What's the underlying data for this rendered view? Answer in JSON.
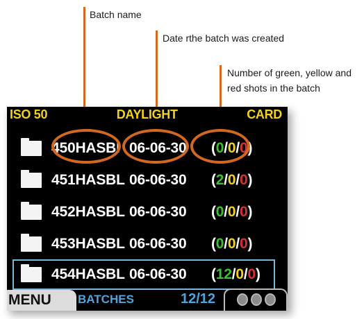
{
  "callouts": {
    "batch_name": "Batch name",
    "date": "Date rthe batch was created",
    "counts_line1": "Number of green, yellow and",
    "counts_line2": "red shots in the batch"
  },
  "topbar": {
    "iso": "ISO 50",
    "wb": "DAYLIGHT",
    "storage": "CARD"
  },
  "batches": [
    {
      "name": "450HASBl",
      "date": "06-06-30",
      "green": "0",
      "yellow": "0",
      "red": "0"
    },
    {
      "name": "451HASBL",
      "date": "06-06-30",
      "green": "2",
      "yellow": "0",
      "red": "0"
    },
    {
      "name": "452HASBL",
      "date": "06-06-30",
      "green": "0",
      "yellow": "0",
      "red": "0"
    },
    {
      "name": "453HASBL",
      "date": "06-06-30",
      "green": "0",
      "yellow": "0",
      "red": "0"
    },
    {
      "name": "454HASBL",
      "date": "06-06-30",
      "green": "12",
      "yellow": "0",
      "red": "0"
    }
  ],
  "bottombar": {
    "menu": "MENU",
    "section": "BATCHES",
    "page": "12/12"
  },
  "colors": {
    "green": "#3fbf34",
    "yellow": "#f3d21a",
    "red": "#d9313a",
    "accent": "#d2691e",
    "selection": "#79b7dd"
  },
  "icons": {
    "folder": "folder-icon",
    "dots": "status-dots-icon"
  }
}
